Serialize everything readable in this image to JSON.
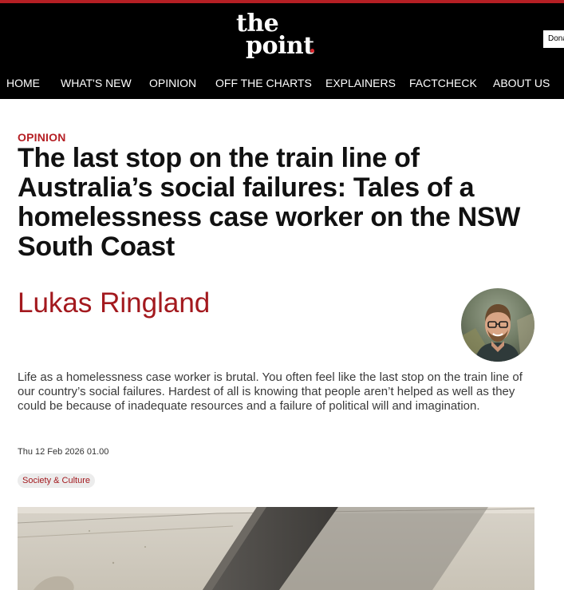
{
  "brand": {
    "logo_line1": "the",
    "logo_line2": "point",
    "accent_color": "#b51f24"
  },
  "header": {
    "donate_label": "Donate"
  },
  "nav": {
    "items": [
      {
        "label": "HOME"
      },
      {
        "label": "WHAT'S NEW"
      },
      {
        "label": "OPINION"
      },
      {
        "label": "OFF THE CHARTS"
      },
      {
        "label": "EXPLAINERS"
      },
      {
        "label": "FACTCHECK"
      },
      {
        "label": "ABOUT US"
      }
    ]
  },
  "article": {
    "kicker": "OPINION",
    "headline": "The last stop on the train line of Australia’s social failures: Tales of a homelessness case worker on the NSW South Coast",
    "author": "Lukas Ringland",
    "standfirst": "Life as a homelessness case worker is brutal. You often feel like the last stop on the train line of our country’s social failures. Hardest of all is knowing that people aren’t helped as well as they could be because of inadequate resources and a failure of political will and imagination.",
    "date": "Thu 12 Feb 2026 01.00",
    "tag": "Society & Culture"
  }
}
